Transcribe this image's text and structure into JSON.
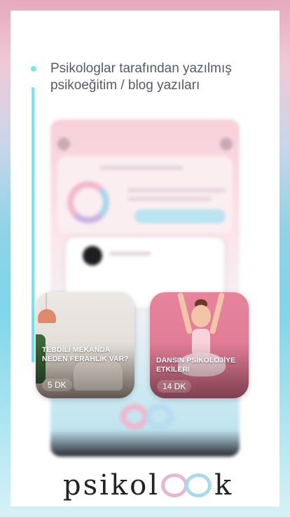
{
  "headline": "Psikologlar tarafından yazılmış psikoeğitim / blog yazıları",
  "articles": [
    {
      "title": "TEBDİLİ MEKANDA NEDEN FERAHLIK VAR?",
      "duration": "5 DK"
    },
    {
      "title": "DANSIN PSİKOLOJİYE ETKİLERİ",
      "duration": "14 DK"
    }
  ],
  "brand": {
    "prefix": "psikol",
    "suffix": "k",
    "logo_icon": "infinity-icon"
  },
  "colors": {
    "accent": "#79e6ee",
    "pink": "#f0b2c8",
    "blue": "#a9d9ec"
  }
}
